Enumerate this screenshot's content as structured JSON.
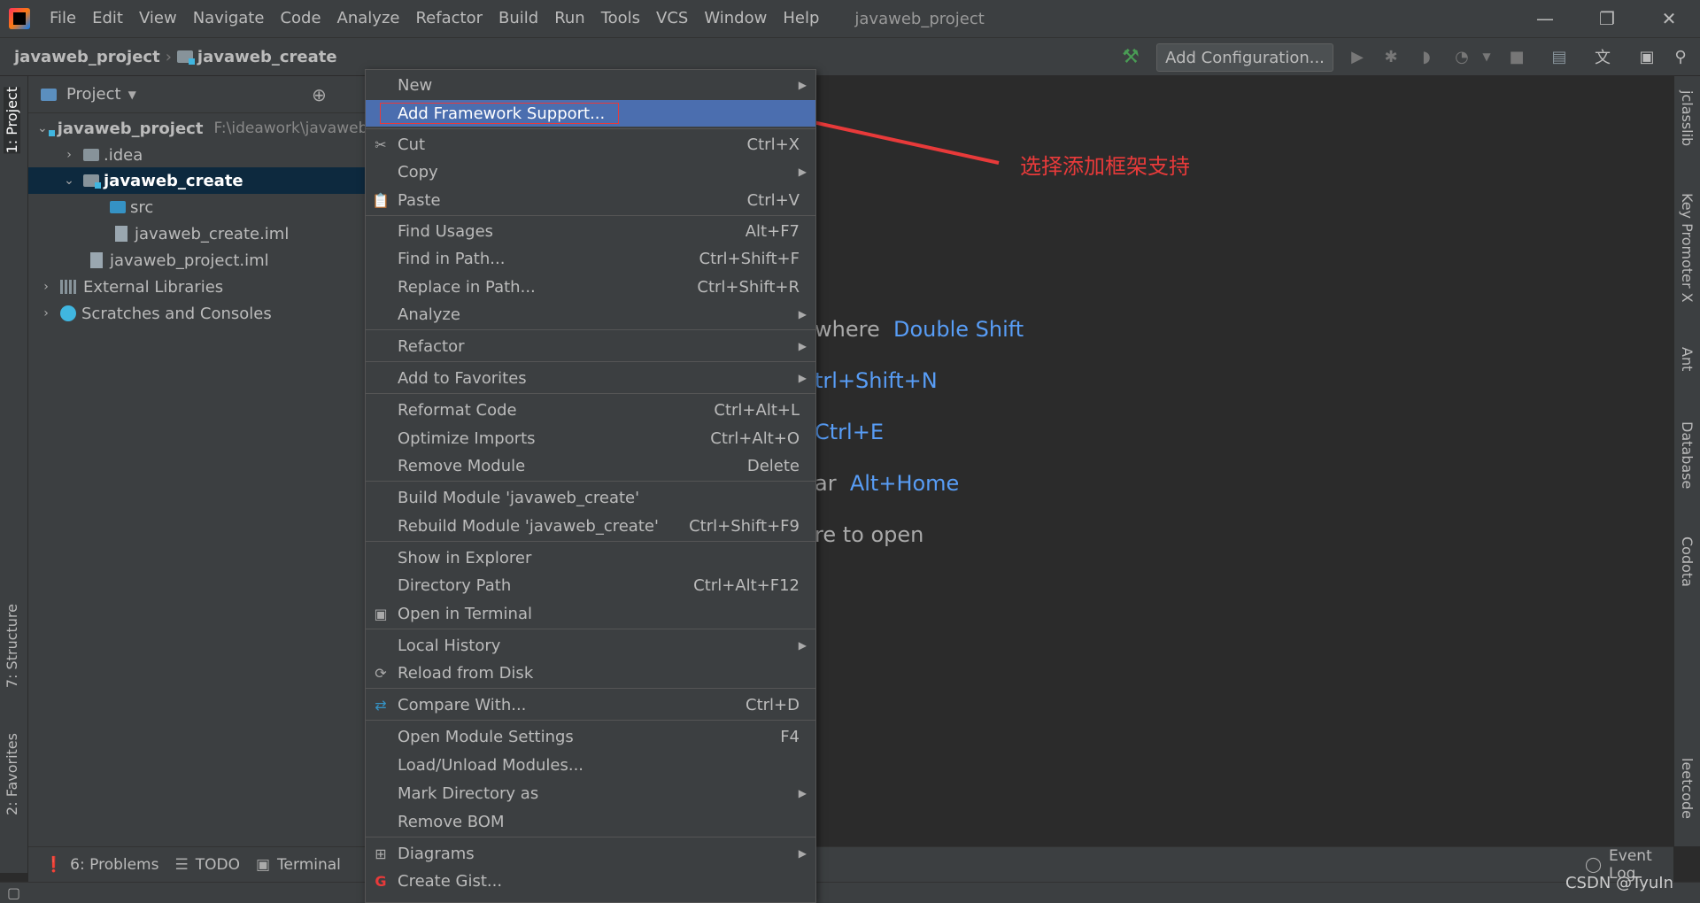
{
  "window": {
    "title": "javaweb_project",
    "minimize": "—",
    "maximize": "❐",
    "close": "✕"
  },
  "menubar": [
    "File",
    "Edit",
    "View",
    "Navigate",
    "Code",
    "Analyze",
    "Refactor",
    "Build",
    "Run",
    "Tools",
    "VCS",
    "Window",
    "Help"
  ],
  "breadcrumb": {
    "project": "javaweb_project",
    "module": "javaweb_create"
  },
  "toolbar": {
    "add_config": "Add Configuration..."
  },
  "left_tabs": {
    "project": "1: Project",
    "structure": "7: Structure",
    "favorites": "2: Favorites"
  },
  "right_tabs": {
    "jclasslib": "jclasslib",
    "key_promoter": "Key Promoter X",
    "ant": "Ant",
    "database": "Database",
    "codota": "Codota",
    "leetcode": "leetcode"
  },
  "project_panel": {
    "header": "Project",
    "tree": [
      {
        "label": "javaweb_project",
        "path": "F:\\ideawork\\javaweb"
      },
      {
        "label": ".idea"
      },
      {
        "label": "javaweb_create"
      },
      {
        "label": "src"
      },
      {
        "label": "javaweb_create.iml"
      },
      {
        "label": "javaweb_project.iml"
      },
      {
        "label": "External Libraries"
      },
      {
        "label": "Scratches and Consoles"
      }
    ]
  },
  "editor_hints": [
    {
      "prefix": "where",
      "key": "Double Shift"
    },
    {
      "prefix": "",
      "key": "trl+Shift+N"
    },
    {
      "prefix": "",
      "key": "Ctrl+E"
    },
    {
      "prefix": "ar",
      "key": "Alt+Home"
    },
    {
      "prefix": "re to open",
      "key": ""
    }
  ],
  "context_menu": {
    "items": [
      {
        "label": "New",
        "shortcut": "",
        "submenu": true
      },
      {
        "label": "Add Framework Support...",
        "shortcut": "",
        "submenu": false
      },
      {
        "label": "Cut",
        "shortcut": "Ctrl+X",
        "submenu": false
      },
      {
        "label": "Copy",
        "shortcut": "",
        "submenu": true
      },
      {
        "label": "Paste",
        "shortcut": "Ctrl+V",
        "submenu": false
      },
      {
        "label": "Find Usages",
        "shortcut": "Alt+F7",
        "submenu": false
      },
      {
        "label": "Find in Path...",
        "shortcut": "Ctrl+Shift+F",
        "submenu": false
      },
      {
        "label": "Replace in Path...",
        "shortcut": "Ctrl+Shift+R",
        "submenu": false
      },
      {
        "label": "Analyze",
        "shortcut": "",
        "submenu": true
      },
      {
        "label": "Refactor",
        "shortcut": "",
        "submenu": true
      },
      {
        "label": "Add to Favorites",
        "shortcut": "",
        "submenu": true
      },
      {
        "label": "Reformat Code",
        "shortcut": "Ctrl+Alt+L",
        "submenu": false
      },
      {
        "label": "Optimize Imports",
        "shortcut": "Ctrl+Alt+O",
        "submenu": false
      },
      {
        "label": "Remove Module",
        "shortcut": "Delete",
        "submenu": false
      },
      {
        "label": "Build Module 'javaweb_create'",
        "shortcut": "",
        "submenu": false
      },
      {
        "label": "Rebuild Module 'javaweb_create'",
        "shortcut": "Ctrl+Shift+F9",
        "submenu": false
      },
      {
        "label": "Show in Explorer",
        "shortcut": "",
        "submenu": false
      },
      {
        "label": "Directory Path",
        "shortcut": "Ctrl+Alt+F12",
        "submenu": false
      },
      {
        "label": "Open in Terminal",
        "shortcut": "",
        "submenu": false
      },
      {
        "label": "Local History",
        "shortcut": "",
        "submenu": true
      },
      {
        "label": "Reload from Disk",
        "shortcut": "",
        "submenu": false
      },
      {
        "label": "Compare With...",
        "shortcut": "Ctrl+D",
        "submenu": false
      },
      {
        "label": "Open Module Settings",
        "shortcut": "F4",
        "submenu": false
      },
      {
        "label": "Load/Unload Modules...",
        "shortcut": "",
        "submenu": false
      },
      {
        "label": "Mark Directory as",
        "shortcut": "",
        "submenu": true
      },
      {
        "label": "Remove BOM",
        "shortcut": "",
        "submenu": false
      },
      {
        "label": "Diagrams",
        "shortcut": "",
        "submenu": true
      },
      {
        "label": "Create Gist...",
        "shortcut": "",
        "submenu": false
      }
    ]
  },
  "annotation": "选择添加框架支持",
  "bottom_tabs": {
    "problems": "6: Problems",
    "todo": "TODO",
    "terminal": "Terminal",
    "event_log": "Event Log"
  },
  "watermark": "CSDN @TyuIn",
  "colors": {
    "accent": "#4b6eaf",
    "annotation": "#e83a3a",
    "shortcut_key": "#589df6"
  }
}
